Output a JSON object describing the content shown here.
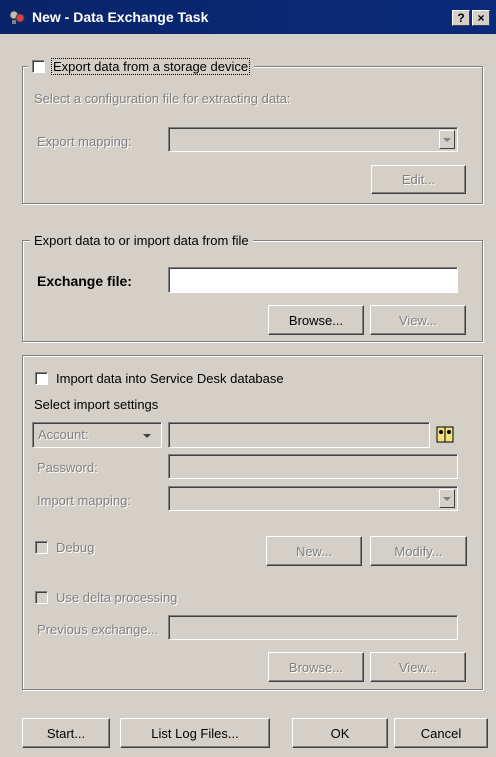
{
  "title": "New - Data Exchange Task",
  "titlebar_buttons": {
    "help": "?",
    "close": "×"
  },
  "export_section": {
    "checkbox_label": "Export data from a storage device",
    "description": "Select a configuration file for extracting data:",
    "mapping_label": "Export mapping:",
    "edit_button": "Edit..."
  },
  "file_section": {
    "legend": "Export data to or import data from file",
    "exchange_label": "Exchange file:",
    "exchange_value": "",
    "browse_button": "Browse...",
    "view_button": "View..."
  },
  "import_section": {
    "checkbox_label": "Import data into Service Desk database",
    "settings_label": "Select import settings",
    "account_select": "Account:",
    "password_label": "Password:",
    "mapping_label": "Import mapping:",
    "debug_label": "Debug",
    "new_button": "New...",
    "modify_button": "Modify...",
    "delta_label": "Use delta processing",
    "previous_label": "Previous exchange...",
    "browse_button": "Browse...",
    "view_button": "View..."
  },
  "footer": {
    "start_button": "Start...",
    "logs_button": "List Log Files...",
    "ok_button": "OK",
    "cancel_button": "Cancel"
  }
}
